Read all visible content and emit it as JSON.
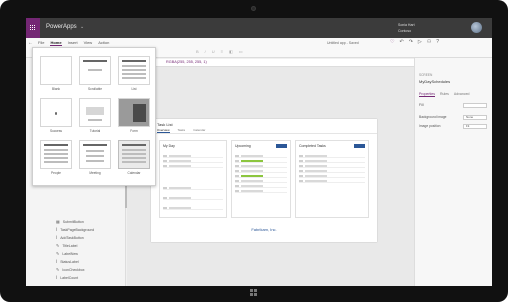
{
  "app": {
    "name": "PowerApps",
    "user_line1": "Sonia Hart",
    "user_line2": "Contoso"
  },
  "ribbon": {
    "tabs": [
      "File",
      "Home",
      "Insert",
      "View",
      "Action"
    ],
    "active_tab": "Home",
    "new_screen_label": "New screen",
    "theme_label": "Theme",
    "font_value": "Open Sans",
    "file_text": "Untitled app - Saved"
  },
  "formula": {
    "text": "RGBA(255, 255, 255, 1)"
  },
  "gallery": {
    "items": [
      {
        "label": "Blank"
      },
      {
        "label": "Scrollable"
      },
      {
        "label": "List"
      },
      {
        "label": "Success"
      },
      {
        "label": "Tutorial"
      },
      {
        "label": "Form"
      },
      {
        "label": "People"
      },
      {
        "label": "Meeting"
      },
      {
        "label": "Calendar"
      }
    ],
    "selected": "Calendar"
  },
  "tree": {
    "items": [
      {
        "icon": "gallery-icon",
        "label": "SubmitButton"
      },
      {
        "icon": "text-icon",
        "label": "TaskPageBackground"
      },
      {
        "icon": "text-icon",
        "label": "AddTaskButton"
      },
      {
        "icon": "edit-icon",
        "label": "TitleLabel"
      },
      {
        "icon": "edit-icon",
        "label": "LabelNew"
      },
      {
        "icon": "text-icon",
        "label": "StatusLabel"
      },
      {
        "icon": "edit-icon",
        "label": "IconCheckbox"
      },
      {
        "icon": "text-icon",
        "label": "LabelCount"
      }
    ]
  },
  "slide": {
    "title": "Task List",
    "tabs": [
      "Overview",
      "Tasks",
      "Calendar"
    ],
    "card1_title": "My Day",
    "card2_title": "Upcoming",
    "card3_title": "Completed Tasks",
    "footer": "Fabrikam, Inc."
  },
  "properties": {
    "screen_label": "SCREEN",
    "screen_name": "MyDaySchedules",
    "tabs": [
      "Properties",
      "Rules",
      "Advanced"
    ],
    "fill_label": "Fill",
    "rows": [
      {
        "label": "Background image",
        "value": "None"
      },
      {
        "label": "Image position",
        "value": "Fit"
      }
    ]
  },
  "colors": {
    "accent": "#742774",
    "title_bar": "#3b3b3b",
    "link_blue": "#2b5797"
  }
}
